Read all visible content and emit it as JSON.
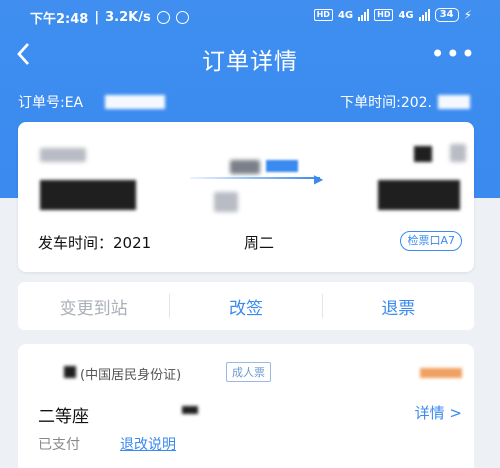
{
  "status_bar": {
    "time": "下午2:48",
    "speed": "3.2K/s",
    "net1": "4G",
    "net2": "4G",
    "hd1": "HD",
    "hd2": "HD",
    "battery": "34"
  },
  "nav": {
    "back_icon": "chevron-left",
    "title": "订单详情",
    "more_icon": "ellipsis"
  },
  "order": {
    "number_label": "订单号:EA",
    "time_label": "下单时间:202."
  },
  "trip": {
    "depart_label": "发车时间：2021",
    "weekday": "周二",
    "gate": "检票口A7"
  },
  "actions": {
    "change_station": "变更到站",
    "reschedule": "改签",
    "refund": "退票"
  },
  "passenger": {
    "id_type": "(中国居民身份证)",
    "ticket_type": "成人票",
    "seat_class": "二等座",
    "detail": "详情 >",
    "pay_status": "已支付",
    "refund_policy": "退改说明"
  },
  "colors": {
    "brand_blue": "#3a8af0",
    "background": "#edf0f5"
  }
}
